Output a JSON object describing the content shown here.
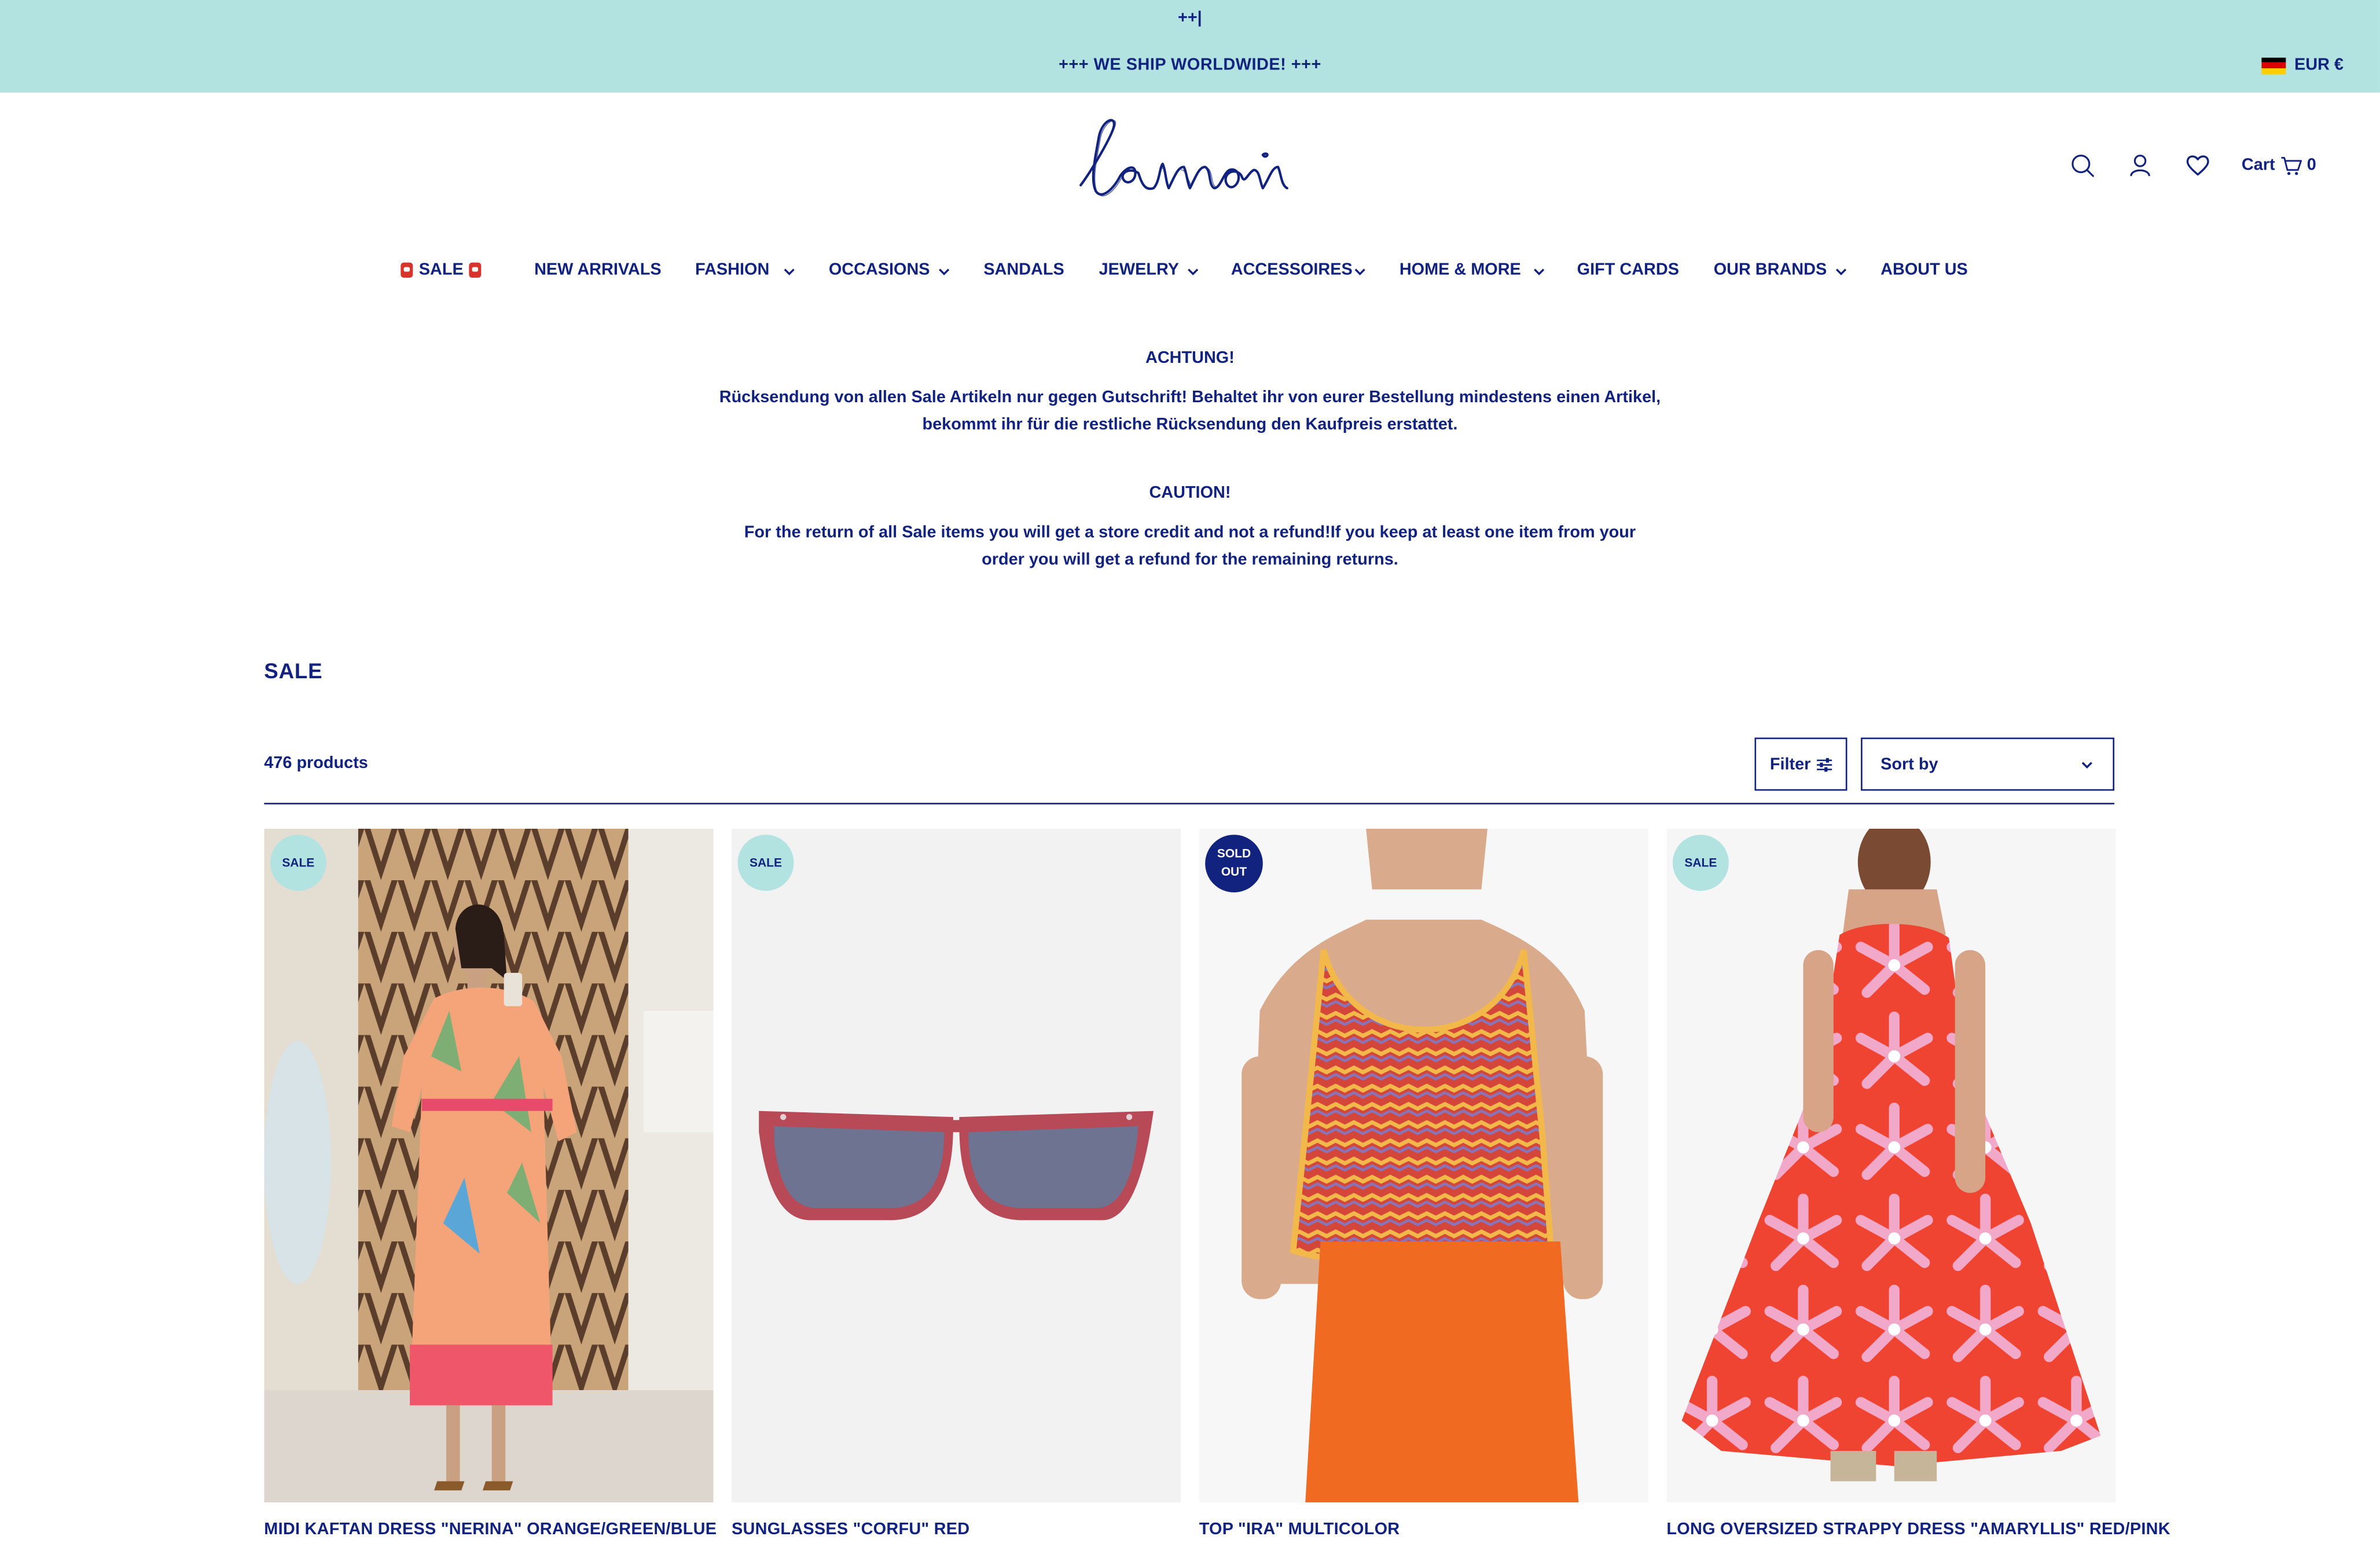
{
  "announcement": {
    "marker": "++|",
    "text": "+++ WE SHIP WORLDWIDE! +++",
    "currency": "EUR €"
  },
  "header": {
    "logo_text": "lemoni",
    "cart_label": "Cart",
    "cart_count": "0"
  },
  "nav": {
    "items": [
      {
        "label": "SALE",
        "has_dropdown": false
      },
      {
        "label": "NEW ARRIVALS",
        "has_dropdown": false
      },
      {
        "label": "FASHION",
        "has_dropdown": true
      },
      {
        "label": "OCCASIONS",
        "has_dropdown": true
      },
      {
        "label": "SANDALS",
        "has_dropdown": false
      },
      {
        "label": "JEWELRY",
        "has_dropdown": true
      },
      {
        "label": "ACCESSOIRES",
        "has_dropdown": true
      },
      {
        "label": "HOME & MORE",
        "has_dropdown": true
      },
      {
        "label": "GIFT CARDS",
        "has_dropdown": false
      },
      {
        "label": "OUR BRANDS",
        "has_dropdown": true
      },
      {
        "label": "ABOUT US",
        "has_dropdown": false
      }
    ]
  },
  "notice": {
    "de_heading": "ACHTUNG!",
    "de_line1": "Rücksendung von allen Sale Artikeln nur gegen Gutschrift! Behaltet ihr von eurer Bestellung mindestens einen Artikel,",
    "de_line2": "bekommt ihr für die restliche Rücksendung den Kaufpreis erstattet.",
    "en_heading": "CAUTION!",
    "en_line1": "For the return of all Sale items you will get a store credit and not a refund!If you keep at least one item from your",
    "en_line2": "order you will get a refund for the remaining returns."
  },
  "collection": {
    "title": "SALE",
    "count": "476 products",
    "filter_label": "Filter",
    "sort_label": "Sort by"
  },
  "products": [
    {
      "title": "MIDI KAFTAN DRESS \"NERINA\" ORANGE/GREEN/BLUE",
      "badge": "SALE"
    },
    {
      "title": "SUNGLASSES \"CORFU\" RED",
      "badge": "SALE"
    },
    {
      "title": "TOP \"IRA\" MULTICOLOR",
      "badge_line1": "SOLD",
      "badge_line2": "OUT"
    },
    {
      "title": "LONG OVERSIZED STRAPPY DRESS \"AMARYLLIS\" RED/PINK",
      "badge": "SALE"
    }
  ],
  "colors": {
    "brand_navy": "#12237f",
    "announcement_bg": "#b3e3e1",
    "sale_badge_bg": "#b3e3e1",
    "sold_badge_bg": "#12237f"
  },
  "icons": [
    "search-icon",
    "account-icon",
    "wishlist-heart-icon",
    "cart-icon",
    "filter-sliders-icon",
    "chevron-down-icon",
    "germany-flag-icon"
  ]
}
